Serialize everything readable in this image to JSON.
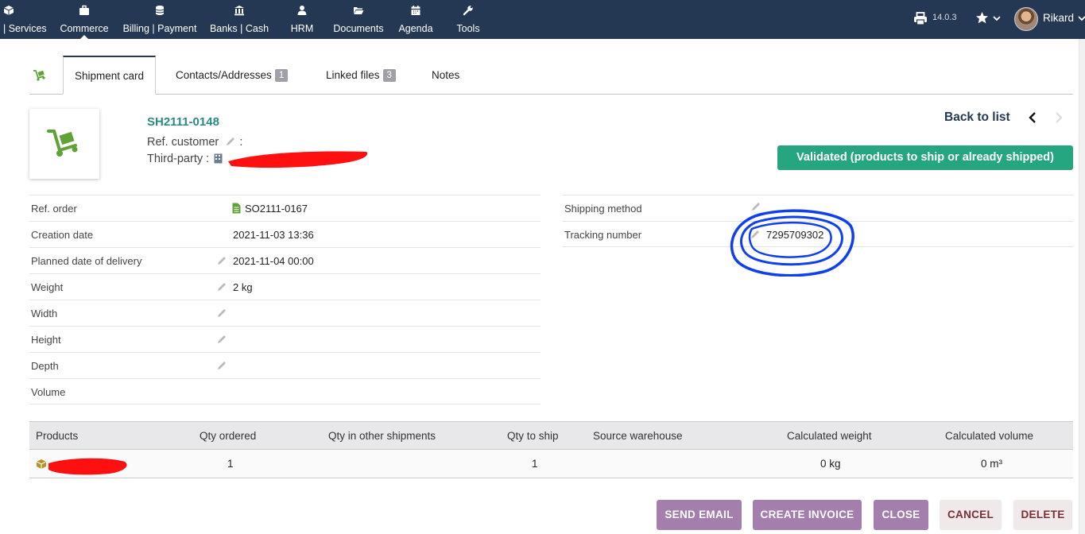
{
  "topnav": {
    "items": [
      {
        "label": "| Services",
        "icon": "cube-icon"
      },
      {
        "label": "Commerce",
        "icon": "briefcase-icon"
      },
      {
        "label": "Billing | Payment",
        "icon": "coins-icon"
      },
      {
        "label": "Banks | Cash",
        "icon": "bank-icon"
      },
      {
        "label": "HRM",
        "icon": "user-icon"
      },
      {
        "label": "Documents",
        "icon": "folder-open-icon"
      },
      {
        "label": "Agenda",
        "icon": "calendar-icon"
      },
      {
        "label": "Tools",
        "icon": "wrench-icon"
      }
    ],
    "active": "Commerce",
    "version": "14.0.3",
    "user": "Rikard"
  },
  "tabs": [
    {
      "label": "Shipment card",
      "badge": null
    },
    {
      "label": "Contacts/Addresses",
      "badge": "1"
    },
    {
      "label": "Linked files",
      "badge": "3"
    },
    {
      "label": "Notes",
      "badge": null
    }
  ],
  "header": {
    "ref": "SH2111-0148",
    "ref_customer_label": "Ref. customer",
    "third_party_label": "Third-party :",
    "back_to_list": "Back to list",
    "status": "Validated (products to ship or already shipped)"
  },
  "fields_left": [
    {
      "label": "Ref. order",
      "value": "SO2111-0167",
      "editable": false,
      "link": true
    },
    {
      "label": "Creation date",
      "value": "2021-11-03 13:36",
      "editable": false
    },
    {
      "label": "Planned date of delivery",
      "value": "2021-11-04 00:00",
      "editable": true
    },
    {
      "label": "Weight",
      "value": "2 kg",
      "editable": true
    },
    {
      "label": "Width",
      "value": "",
      "editable": true
    },
    {
      "label": "Height",
      "value": "",
      "editable": true
    },
    {
      "label": "Depth",
      "value": "",
      "editable": true
    },
    {
      "label": "Volume",
      "value": "",
      "editable": false
    }
  ],
  "fields_right": [
    {
      "label": "Shipping method",
      "value": ""
    },
    {
      "label": "Tracking number",
      "value": "7295709302"
    }
  ],
  "products_table": {
    "columns": [
      "Products",
      "Qty ordered",
      "Qty in other shipments",
      "Qty to ship",
      "Source warehouse",
      "Calculated weight",
      "Calculated volume"
    ],
    "rows": [
      {
        "product": "",
        "qty_ordered": "1",
        "qty_other": "",
        "qty_to_ship": "1",
        "warehouse": "",
        "weight": "0 kg",
        "volume": "0 m³"
      }
    ]
  },
  "actions": [
    "SEND EMAIL",
    "CREATE INVOICE",
    "CLOSE",
    "CANCEL",
    "DELETE"
  ],
  "colors": {
    "topbar": "#253853",
    "status": "#25a580",
    "action_primary": "#a47fad",
    "action_secondary": "#f0e9ea",
    "annotation": "#1040ee",
    "redaction": "#ff1010"
  }
}
